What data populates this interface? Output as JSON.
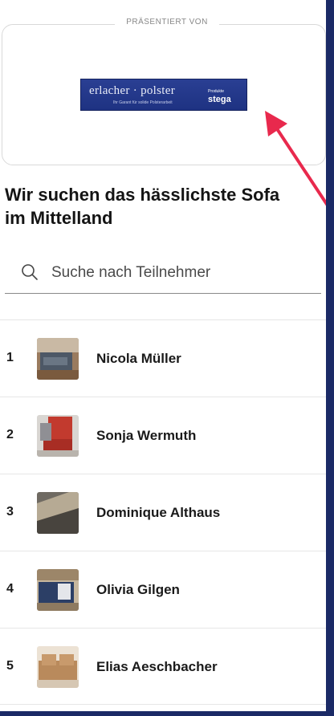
{
  "sponsor": {
    "caption": "PRÄSENTIERT VON",
    "logo_wordmark": "erlacher · polster",
    "logo_tagline": "Ihr Garant für solide Polsterarbeit",
    "logo_partner_small": "Produkte",
    "logo_partner_brand": "stega"
  },
  "heading": "Wir suchen das hässlichste Sofa im Mittelland",
  "search": {
    "placeholder": "Suche nach Teilnehmer"
  },
  "participants": [
    {
      "rank": "1",
      "name": "Nicola Müller"
    },
    {
      "rank": "2",
      "name": "Sonja Wermuth"
    },
    {
      "rank": "3",
      "name": "Dominique Althaus"
    },
    {
      "rank": "4",
      "name": "Olivia Gilgen"
    },
    {
      "rank": "5",
      "name": "Elias Aeschbacher"
    }
  ],
  "colors": {
    "frame": "#1b2a66",
    "logo_background": "#22388a",
    "annotation_arrow": "#e8294d"
  }
}
